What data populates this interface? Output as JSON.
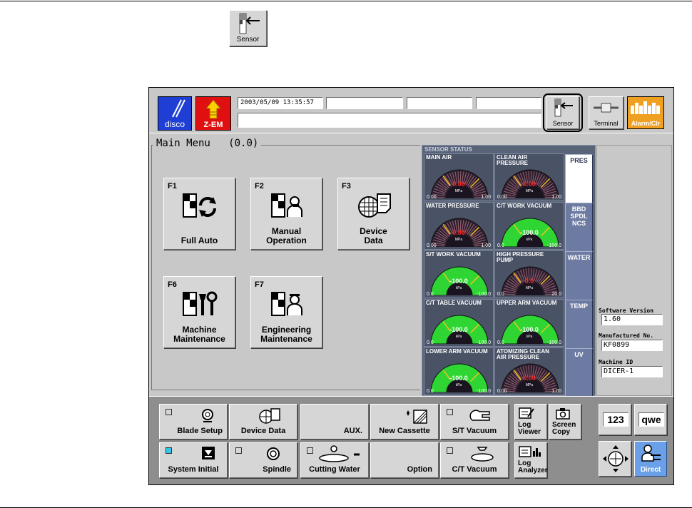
{
  "top_icon": {
    "label": "Sensor"
  },
  "header": {
    "logo_disco": "disco",
    "logo_zem": "Z-EM",
    "datetime": "2003/05/09 13:35:57",
    "buttons": {
      "sensor": "Sensor",
      "terminal": "Terminal",
      "alarm": "Alarm/Clr"
    }
  },
  "main_menu": {
    "title": "Main Menu",
    "code": "(0.0)",
    "items": [
      {
        "key": "F1",
        "label": "Full Auto"
      },
      {
        "key": "F2",
        "label": "Manual Operation"
      },
      {
        "key": "F3",
        "label": "Device Data"
      },
      {
        "key": "F6",
        "label": "Machine Maintenance"
      },
      {
        "key": "F7",
        "label": "Engineering Maintenance"
      }
    ]
  },
  "sensor_status": {
    "title": "SENSOR STATUS",
    "gauges": [
      {
        "label": "MAIN AIR",
        "value": "0.00",
        "unit": "MPa",
        "min": "0.00",
        "max": "1.00",
        "fraction": 0.0,
        "type": "dark",
        "value_color": "#ff2a2a"
      },
      {
        "label": "CLEAN AIR\nPRESSURE",
        "value": "0.00",
        "unit": "MPa",
        "min": "0.00",
        "max": "1.00",
        "fraction": 0.0,
        "type": "dark",
        "value_color": "#ff2a2a"
      },
      {
        "label": "WATER PRESSURE",
        "value": "0.00",
        "unit": "MPa",
        "min": "0.00",
        "max": "1.00",
        "fraction": 0.0,
        "type": "dark",
        "value_color": "#ff2a2a"
      },
      {
        "label": "C/T WORK VACUUM",
        "value": "-100.0",
        "unit": "kPa",
        "min": "0.0",
        "max": "-100.0",
        "fraction": 1.0,
        "type": "green",
        "value_color": "#ffffff"
      },
      {
        "label": "S/T WORK VACUUM",
        "value": "-100.0",
        "unit": "kPa",
        "min": "0.0",
        "max": "-100.0",
        "fraction": 1.0,
        "type": "green",
        "value_color": "#ffffff"
      },
      {
        "label": "HIGH PRESSURE\nPUMP",
        "value": "0.0",
        "unit": "MPa",
        "min": "0.0",
        "max": "20.0",
        "fraction": 0.0,
        "type": "dark",
        "value_color": "#ff2a2a"
      },
      {
        "label": "C/T TABLE VACUUM",
        "value": "-100.0",
        "unit": "kPa",
        "min": "0.0",
        "max": "-100.0",
        "fraction": 1.0,
        "type": "green",
        "value_color": "#ffffff"
      },
      {
        "label": "UPPER ARM VACUUM",
        "value": "-100.0",
        "unit": "kPa",
        "min": "0.0",
        "max": "-100.0",
        "fraction": 1.0,
        "type": "green",
        "value_color": "#ffffff"
      },
      {
        "label": "LOWER ARM VACUUM",
        "value": "-100.0",
        "unit": "kPa",
        "min": "0.0",
        "max": "-100.0",
        "fraction": 1.0,
        "type": "green",
        "value_color": "#ffffff"
      },
      {
        "label": "ATOMIZING CLEAN\nAIR PRESSURE",
        "value": "0.00",
        "unit": "MPa",
        "min": "0.00",
        "max": "1.00",
        "fraction": 0.0,
        "type": "dark",
        "value_color": "#ff2a2a"
      }
    ],
    "tabs": [
      {
        "label": "PRES",
        "active": true
      },
      {
        "label": "BBD\nSPDL\nNCS",
        "active": false
      },
      {
        "label": "WATER",
        "active": false
      },
      {
        "label": "TEMP",
        "active": false
      },
      {
        "label": "UV",
        "active": false
      }
    ]
  },
  "info": {
    "software_version_label": "Software Version",
    "software_version": "1.60",
    "manufactured_label": "Manufactured No.",
    "manufactured": "KF0899",
    "machine_id_label": "Machine ID",
    "machine_id": "DICER-1"
  },
  "bottom": {
    "blade_setup": "Blade Setup",
    "device_data": "Device Data",
    "aux": "AUX.",
    "new_cassette": "New Cassette",
    "st_vacuum": "S/T Vacuum",
    "log_viewer": "Log Viewer",
    "screen_copy": "Screen Copy",
    "system_initial": "System Initial",
    "spindle": "Spindle",
    "cutting_water": "Cutting Water",
    "option": "Option",
    "ct_vacuum": "C/T Vacuum",
    "log_analyzer": "Log Analyzer",
    "num_keypad": "123",
    "text_keypad": "qwe",
    "direct": "Direct"
  },
  "colors": {
    "disco_blue": "#1f3fd4",
    "zem_red": "#e01010",
    "alarm_orange": "#f0a020",
    "panel_bg": "#d6d6d6",
    "sensor_bg": "#5a6478",
    "gauge_green": "#2fd633",
    "direct_blue": "#6aa0e8"
  }
}
